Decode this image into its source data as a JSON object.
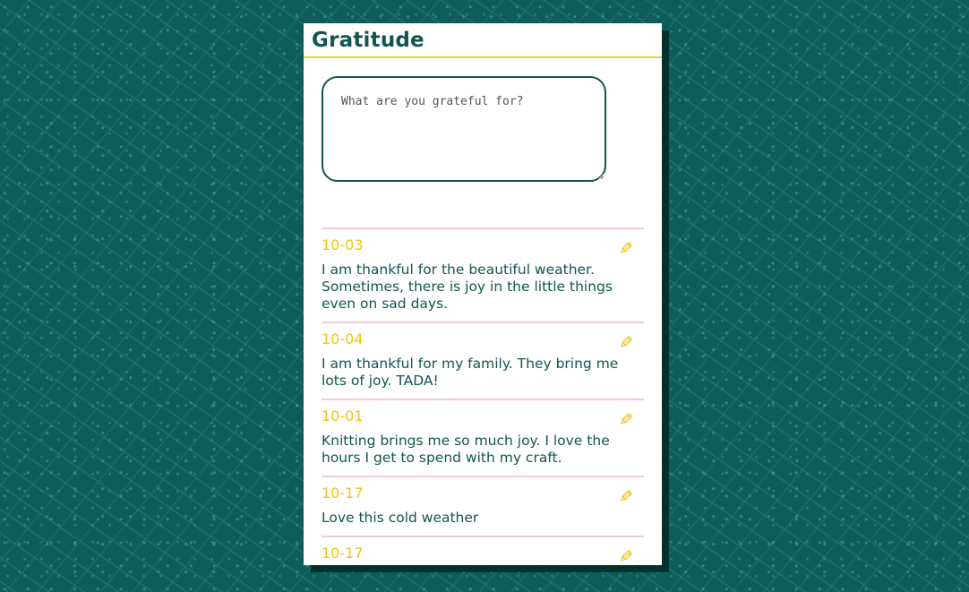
{
  "app": {
    "title": "Gratitude"
  },
  "form": {
    "placeholder": "What are you grateful for?",
    "value": ""
  },
  "entries": [
    {
      "date": "10-03",
      "text": "I am thankful for the beautiful weather. Sometimes, there is joy in the little things even on sad days.",
      "edit_icon": "pencil-icon"
    },
    {
      "date": "10-04",
      "text": "I am thankful for my family. They bring me lots of joy. TADA!",
      "edit_icon": "pencil-icon"
    },
    {
      "date": "10-01",
      "text": "Knitting brings me so much joy. I love the hours I get to spend with my craft.",
      "edit_icon": "pencil-icon"
    },
    {
      "date": "10-17",
      "text": "Love this cold weather",
      "edit_icon": "pencil-icon"
    },
    {
      "date": "10-17",
      "text": "",
      "edit_icon": "pencil-icon"
    }
  ],
  "colors": {
    "background": "#0f5d5b",
    "accent": "#f0c419",
    "primary": "#10564f",
    "divider": "#f6c8d2"
  }
}
